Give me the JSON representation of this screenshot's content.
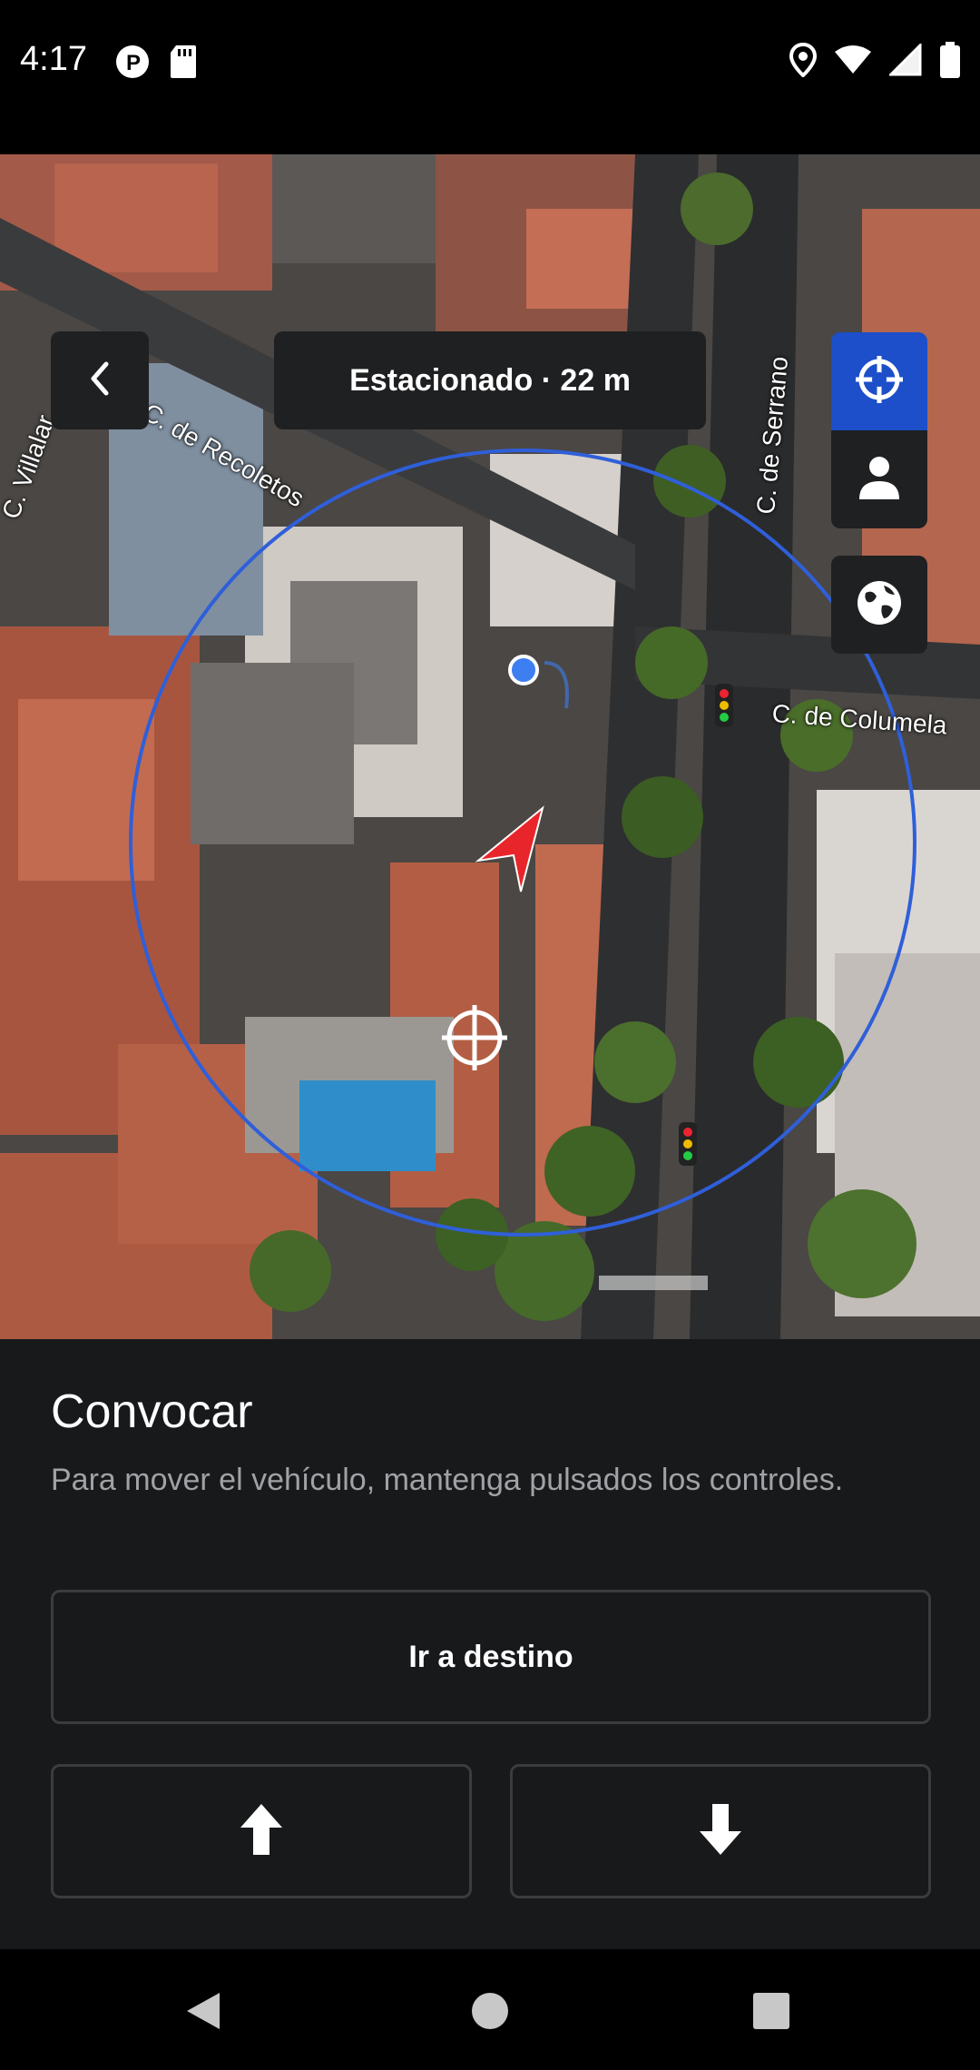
{
  "status_bar": {
    "time": "4:17",
    "icons_left": [
      "p-circle-icon",
      "sd-card-icon"
    ],
    "icons_right": [
      "location-pin-icon",
      "wifi-icon",
      "signal-icon",
      "battery-icon"
    ]
  },
  "map": {
    "status_chip": "Estacionado · 22 m",
    "street_labels": {
      "recoletos": "C. de Recoletos",
      "villalar": "C. Villalar",
      "serrano": "C. de Serrano",
      "columela": "C. de Columela"
    },
    "controls": [
      "crosshair-icon",
      "person-icon",
      "globe-icon"
    ],
    "colors": {
      "radius_circle": "#2f5fd9",
      "vehicle_arrow": "#e8252a",
      "user_dot": "#3d7ff0",
      "active_control": "#1c4fc9"
    }
  },
  "sheet": {
    "title": "Convocar",
    "description": "Para mover el vehículo, mantenga pulsados los controles.",
    "destination_button": "Ir a destino"
  },
  "nav_bar": [
    "back-icon",
    "home-icon",
    "recents-icon"
  ]
}
